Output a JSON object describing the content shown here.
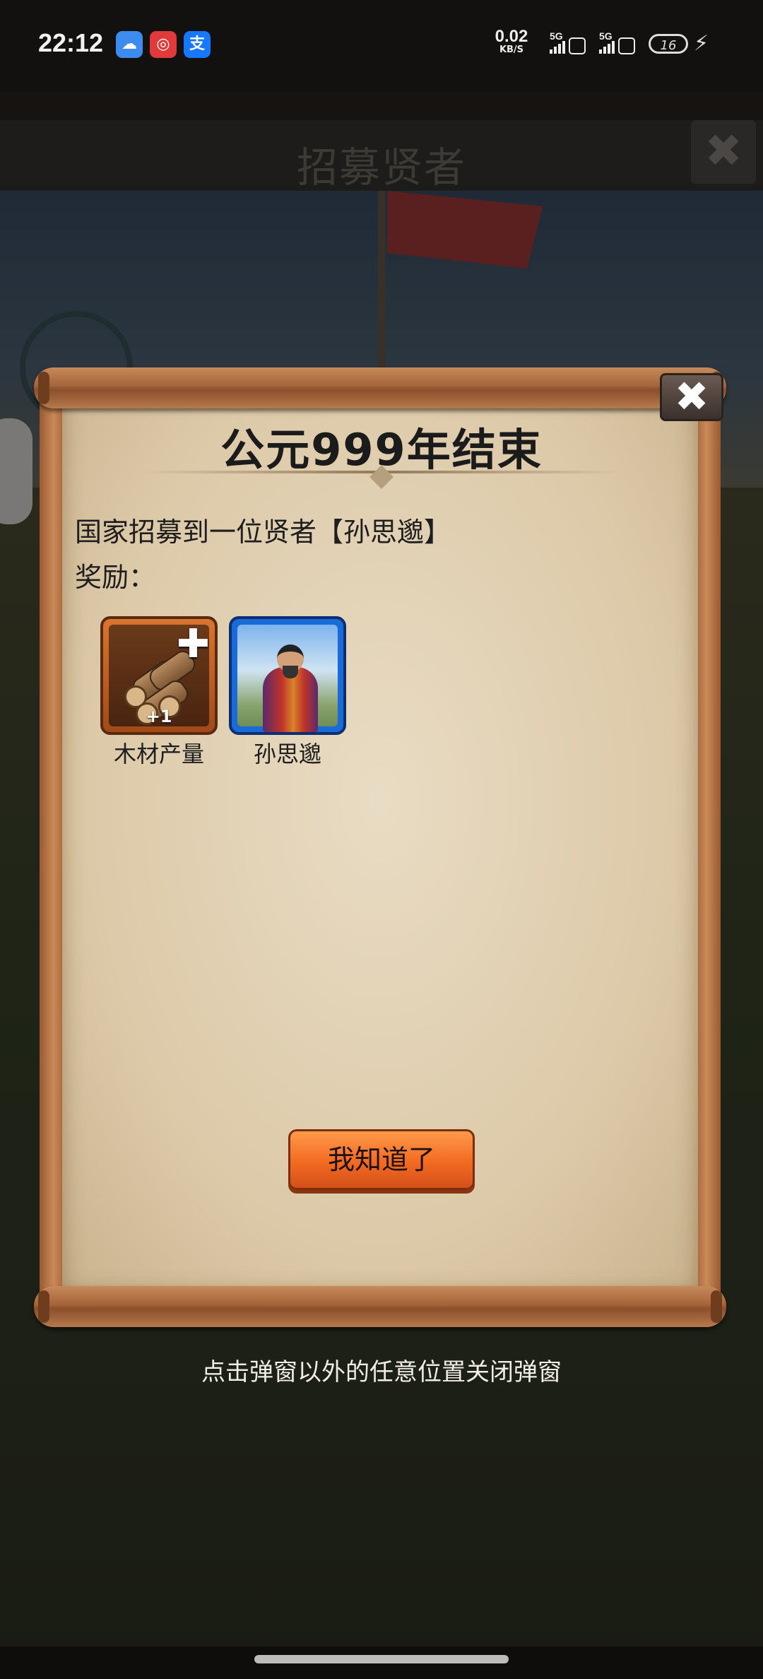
{
  "status_bar": {
    "time": "22:12",
    "apps": [
      {
        "icon": "weather-app-icon",
        "glyph": "☁"
      },
      {
        "icon": "netease-music-app-icon",
        "glyph": "◎"
      },
      {
        "icon": "alipay-app-icon",
        "glyph": "支"
      }
    ],
    "net_speed_value": "0.02",
    "net_speed_unit": "KB/S",
    "signal1_label": "5G",
    "signal2_label": "5G",
    "battery": "16"
  },
  "background": {
    "title": "招募贤者",
    "close_glyph": "✖"
  },
  "dialog": {
    "title": "公元999年结束",
    "close_glyph": "✖",
    "message": "国家招募到一位贤者【孙思邈】",
    "reward_label": "奖励：",
    "rewards": [
      {
        "name": "木材产量",
        "badge": "+1",
        "plus": "✚",
        "icon": "wood-logs-icon",
        "color": "#d87530"
      },
      {
        "name": "孙思邈",
        "icon": "hero-portrait-icon",
        "color": "#1a6ad8"
      }
    ],
    "confirm_button": "我知道了"
  },
  "hint": "点击弹窗以外的任意位置关闭弹窗"
}
